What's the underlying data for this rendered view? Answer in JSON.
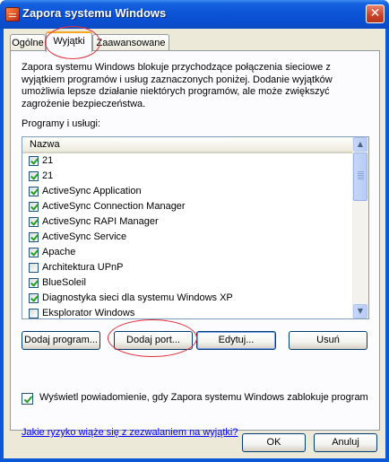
{
  "window": {
    "title": "Zapora systemu Windows",
    "close_glyph": "✕"
  },
  "tabs": [
    {
      "label": "Ogólne",
      "active": false
    },
    {
      "label": "Wyjątki",
      "active": true
    },
    {
      "label": "Zaawansowane",
      "active": false
    }
  ],
  "description": "Zapora systemu Windows blokuje przychodzące połączenia sieciowe z wyjątkiem programów i usług zaznaczonych poniżej. Dodanie wyjątków umożliwia lepsze działanie niektórych programów, ale może zwiększyć zagrożenie bezpieczeństwa.",
  "programs": {
    "group_label": "Programy i usługi:",
    "column_header": "Nazwa",
    "items": [
      {
        "label": "21",
        "checked": true
      },
      {
        "label": "21",
        "checked": true
      },
      {
        "label": "ActiveSync Application",
        "checked": true
      },
      {
        "label": "ActiveSync Connection Manager",
        "checked": true
      },
      {
        "label": "ActiveSync RAPI Manager",
        "checked": true
      },
      {
        "label": "ActiveSync Service",
        "checked": true
      },
      {
        "label": "Apache",
        "checked": true
      },
      {
        "label": "Architektura UPnP",
        "checked": false
      },
      {
        "label": "BlueSoleil",
        "checked": true
      },
      {
        "label": "Diagnostyka sieci dla systemu Windows XP",
        "checked": true
      },
      {
        "label": "Eksplorator Windows",
        "checked": false
      }
    ]
  },
  "buttons": {
    "add_program": "Dodaj program...",
    "add_port": "Dodaj port...",
    "edit": "Edytuj...",
    "remove": "Usuń",
    "ok": "OK",
    "cancel": "Anuluj"
  },
  "notify": {
    "label": "Wyświetl powiadomienie, gdy Zapora systemu Windows zablokuje program",
    "checked": true
  },
  "risk_link": "Jakie ryzyko wiąże się z zezwalaniem na wyjątki?",
  "colors": {
    "annotation": "#e0303a",
    "titlebar": "#0a58d6",
    "link": "#0000ff"
  }
}
